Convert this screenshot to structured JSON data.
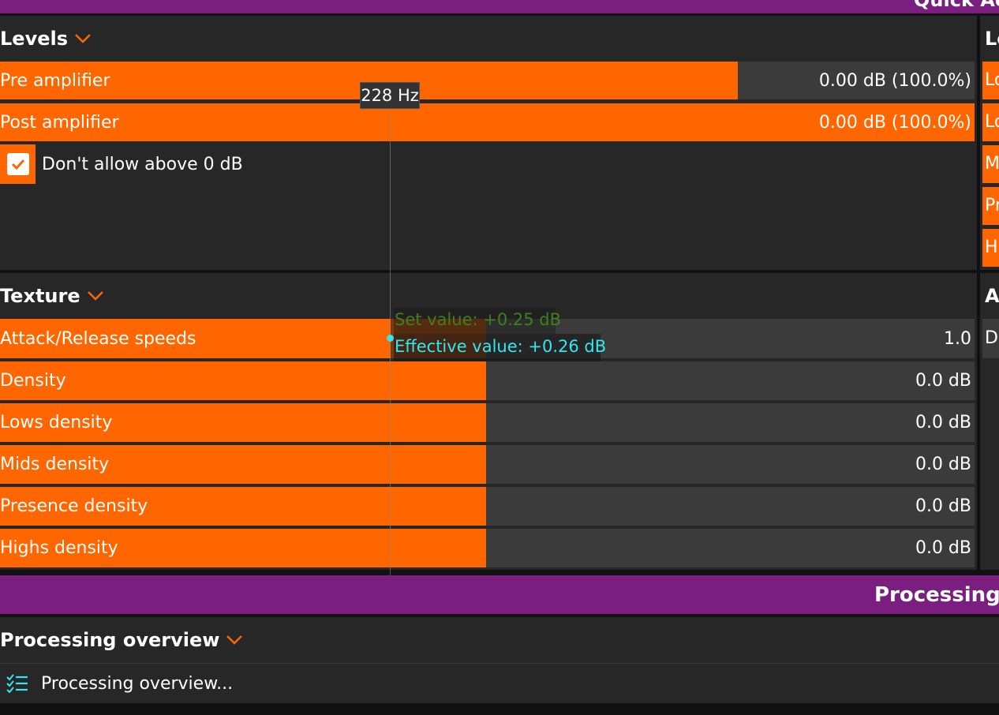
{
  "top_header": {
    "title": "Quick Ac"
  },
  "levels": {
    "title": "Levels",
    "sliders": [
      {
        "label": "Pre amplifier",
        "value": "0.00 dB (100.0%)",
        "level": 0.755
      },
      {
        "label": "Post amplifier",
        "value": "0.00 dB (100.0%)",
        "level": 1.0
      }
    ],
    "checkbox_label": "Don't allow above 0 dB",
    "checkbox_checked": true
  },
  "right_col": {
    "section1_title": "Le",
    "section1_items": [
      "Lo",
      "Lo",
      "M",
      "Pr",
      "H"
    ],
    "section2_title": "A",
    "section2_item": "D"
  },
  "texture": {
    "title": "Texture",
    "sliders": [
      {
        "label": "Attack/Release speeds",
        "value": "1.0",
        "level": 0.5
      },
      {
        "label": "Density",
        "value": "0.0 dB",
        "level": 0.5
      },
      {
        "label": "Lows density",
        "value": "0.0 dB",
        "level": 0.5
      },
      {
        "label": "Mids density",
        "value": "0.0 dB",
        "level": 0.5
      },
      {
        "label": "Presence density",
        "value": "0.0 dB",
        "level": 0.5
      },
      {
        "label": "Highs density",
        "value": "0.0 dB",
        "level": 0.5
      }
    ]
  },
  "tooltip": {
    "freq": "228 Hz",
    "set_value": "Set value: +0.25 dB",
    "effective_value": "Effective value: +0.26 dB"
  },
  "processing_header": {
    "title": "Processing c"
  },
  "processing": {
    "title": "Processing overview",
    "item_label": "Processing overview..."
  },
  "colors": {
    "accent": "#ff6600",
    "band": "#7a1f7f",
    "panel": "#272727",
    "track": "#3b3b3b",
    "cyan": "#33e6f0",
    "green": "#3f7f1f"
  }
}
